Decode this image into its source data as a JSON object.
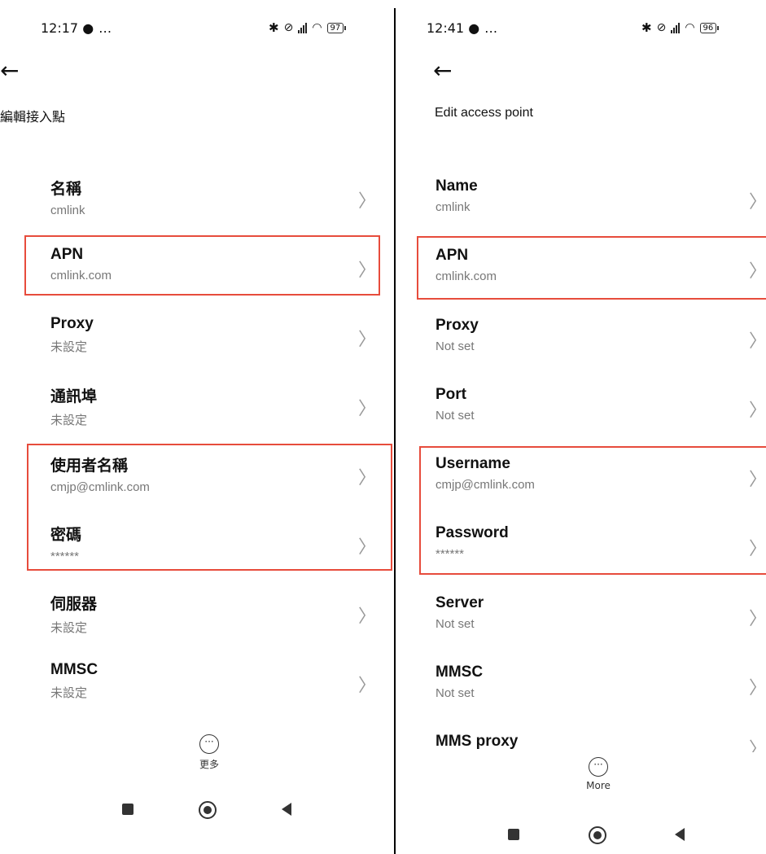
{
  "left": {
    "status": {
      "time": "12:17",
      "dots": "…",
      "battery": "97"
    },
    "title": "編輯接入點",
    "items": [
      {
        "label": "名稱",
        "value": "cmlink"
      },
      {
        "label": "APN",
        "value": "cmlink.com"
      },
      {
        "label": "Proxy",
        "value": "未設定"
      },
      {
        "label": "通訊埠",
        "value": "未設定"
      },
      {
        "label": "使用者名稱",
        "value": "cmjp@cmlink.com"
      },
      {
        "label": "密碼",
        "value": "******"
      },
      {
        "label": "伺服器",
        "value": "未設定"
      },
      {
        "label": "MMSC",
        "value": "未設定"
      }
    ],
    "more_label": "更多"
  },
  "right": {
    "status": {
      "time": "12:41",
      "dots": "…",
      "battery": "96"
    },
    "title": "Edit access point",
    "items": [
      {
        "label": "Name",
        "value": "cmlink"
      },
      {
        "label": "APN",
        "value": "cmlink.com"
      },
      {
        "label": "Proxy",
        "value": "Not set"
      },
      {
        "label": "Port",
        "value": "Not set"
      },
      {
        "label": "Username",
        "value": "cmjp@cmlink.com"
      },
      {
        "label": "Password",
        "value": "******"
      },
      {
        "label": "Server",
        "value": "Not set"
      },
      {
        "label": "MMSC",
        "value": "Not set"
      },
      {
        "label": "MMS proxy",
        "value": ""
      }
    ],
    "more_label": "More"
  },
  "icons": {
    "back": "back-arrow-icon",
    "chevron": "chevron-right-icon",
    "more": "more-icon",
    "bluetooth": "bluetooth-icon",
    "wifi": "wifi-icon",
    "signal": "signal-icon",
    "mute": "mute-icon",
    "message": "message-icon"
  },
  "colors": {
    "highlight": "#e74c3c"
  }
}
